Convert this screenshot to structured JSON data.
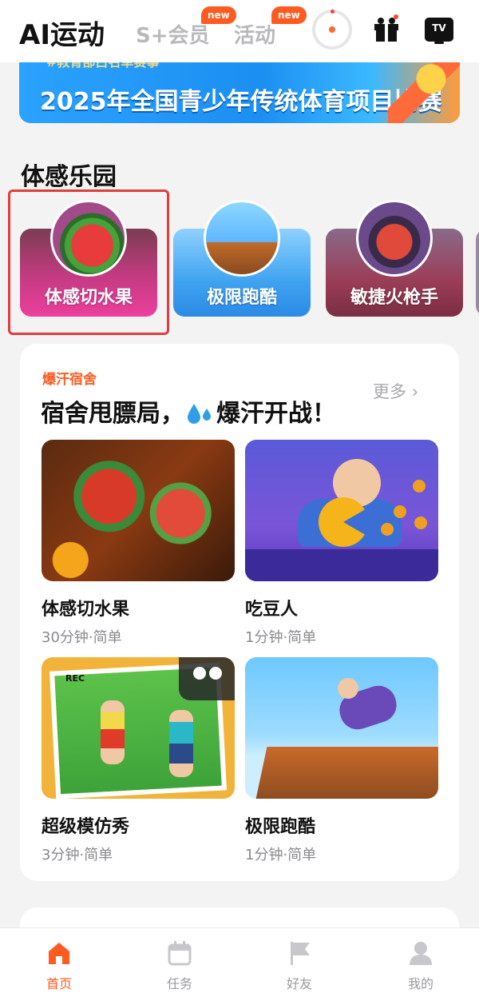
{
  "header": {
    "tabs": [
      {
        "label": "AI运动",
        "active": true
      },
      {
        "label": "S+会员",
        "badge": "new"
      },
      {
        "label": "活动",
        "badge": "new"
      }
    ],
    "tv_label": "TV",
    "icons": [
      "ring-icon",
      "gift-icon",
      "tv-icon"
    ]
  },
  "banner": {
    "subtitle": "#教育部白名单赛事",
    "title": "2025年全国青少年传统体育项目比赛"
  },
  "motion_park": {
    "title": "体感乐园",
    "games": [
      {
        "label": "体感切水果"
      },
      {
        "label": "极限跑酷"
      },
      {
        "label": "敏捷火枪手"
      }
    ]
  },
  "dorm_card": {
    "tag": "爆汗宿舍",
    "heading_left": "宿舍甩膘局，",
    "heading_right": "爆汗开战！",
    "more": "更多",
    "games": [
      {
        "name": "体感切水果",
        "meta": "30分钟·简单"
      },
      {
        "name": "吃豆人",
        "meta": "1分钟·简单"
      },
      {
        "name": "超级模仿秀",
        "meta": "3分钟·简单"
      },
      {
        "name": "极限跑酷",
        "meta": "1分钟·简单"
      }
    ],
    "rec_label": "REC"
  },
  "bottom_nav": {
    "items": [
      {
        "label": "首页",
        "icon": "home-icon",
        "active": true
      },
      {
        "label": "任务",
        "icon": "calendar-icon"
      },
      {
        "label": "好友",
        "icon": "flag-icon"
      },
      {
        "label": "我的",
        "icon": "user-icon"
      }
    ]
  },
  "colors": {
    "accent": "#ff5a1f",
    "highlight_border": "#e23c3c"
  }
}
